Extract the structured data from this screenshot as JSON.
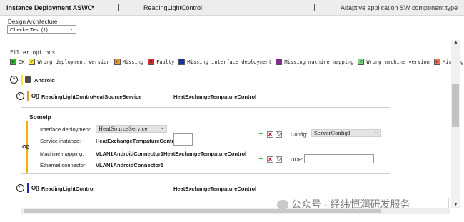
{
  "header": {
    "title": "Instance Deployment ASWC",
    "caret": "▾",
    "component": "ReadingLightControl",
    "component_type": "Adaptive application SW component type"
  },
  "design_architecture": {
    "label": "Design Architecture",
    "value": "CheckerTest (1)",
    "chevron": "⌄"
  },
  "filter": {
    "title": "Filter options",
    "options": [
      {
        "label": "OK",
        "checked": true,
        "color": "#2fb52f"
      },
      {
        "label": "Wrong deployment version",
        "checked": true,
        "color": "#f3e63c"
      },
      {
        "label": "Missing",
        "checked": true,
        "color": "#e89a2c"
      },
      {
        "label": "Faulty",
        "checked": true,
        "color": "#d32f2f"
      },
      {
        "label": "Missing interface deployment",
        "checked": false,
        "color": "#1a2fb0"
      },
      {
        "label": "Missing machine mapping",
        "checked": false,
        "color": "#7d2d8c"
      },
      {
        "label": "Wrong machine version",
        "checked": true,
        "color": "#7fd27f"
      },
      {
        "label": "Missing",
        "checked": true,
        "color": "#e8754e"
      }
    ]
  },
  "machine": {
    "toggle": "^",
    "name": "Android",
    "icon": "android-device-icon",
    "bar_color": "#f3e63c"
  },
  "instance1": {
    "toggle": "^",
    "port": "O▯",
    "name": "ReadingLightControl",
    "service": "HeatSourceService",
    "port_name": "HeatExchangeTempatureControl",
    "bar_color": "#e89a2c"
  },
  "someip": {
    "title": "SomeIp",
    "interface_deployment_label": "Interface deployment:",
    "interface_deployment_value": "HeatSourceService",
    "service_instance_label": "Service instance:",
    "service_instance_value": "HeatExchangeTempatureControl",
    "config_label": "Config:",
    "config_value": "ServerConfig1",
    "port": "O▯",
    "machine_mapping_label": "Machine mapping:",
    "machine_mapping_value": "VLAN1AndroidConnector1HeatExchangeTempatureControl",
    "ethernet_connector_label": "Ethernet connector:",
    "ethernet_connector_value": "VLAN1AndroidConnector1",
    "udp_label": "UDP:",
    "add": "+",
    "remove": "✕",
    "refresh": "↻",
    "chevron": "⌄"
  },
  "instance2": {
    "toggle": "^",
    "port": "O▯",
    "name": "ReadingLightControl",
    "port_name": "HeatExchangeTempatureControl",
    "bar_color": "#1a2fb0"
  },
  "scrollbar": {
    "up": "▲",
    "down": "▼"
  },
  "watermark": {
    "text": "公众号 · 经纬恒润研发服务"
  }
}
